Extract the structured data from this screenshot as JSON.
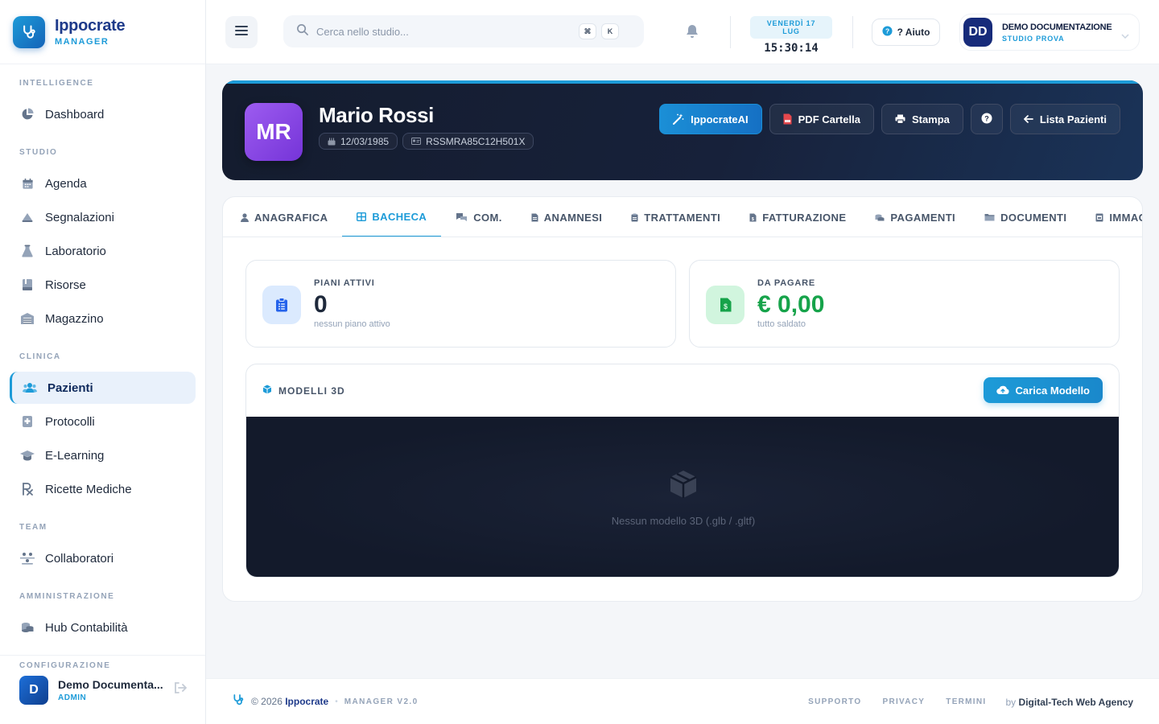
{
  "brand": {
    "name": "Ippocrate",
    "sub": "MANAGER"
  },
  "sidebar": {
    "sections": {
      "intelligence": "INTELLIGENCE",
      "studio": "STUDIO",
      "clinica": "CLINICA",
      "team": "TEAM",
      "amministrazione": "AMMINISTRAZIONE",
      "configurazione": "CONFIGURAZIONE"
    },
    "items": {
      "dashboard": "Dashboard",
      "agenda": "Agenda",
      "segnalazioni": "Segnalazioni",
      "laboratorio": "Laboratorio",
      "risorse": "Risorse",
      "magazzino": "Magazzino",
      "pazienti": "Pazienti",
      "protocolli": "Protocolli",
      "elearning": "E-Learning",
      "ricette": "Ricette Mediche",
      "collaboratori": "Collaboratori",
      "hub": "Hub Contabilità"
    },
    "active": "Pazienti",
    "user": {
      "initial": "D",
      "name": "Demo Documenta...",
      "role": "ADMIN"
    }
  },
  "topbar": {
    "search_placeholder": "Cerca nello studio...",
    "kbd": [
      "⌘",
      "K"
    ],
    "date": "VENERDÌ 17 LUG",
    "time": "15:30:14",
    "help_label": "? Aiuto",
    "user": {
      "initials": "DD",
      "name": "DEMO DOCUMENTAZIONE",
      "sub": "STUDIO PROVA"
    }
  },
  "patient": {
    "initials": "MR",
    "name": "Mario Rossi",
    "birth_date": "12/03/1985",
    "fiscal_code": "RSSMRA85C12H501X",
    "actions": {
      "ai": "IppocrateAI",
      "pdf": "PDF Cartella",
      "print": "Stampa",
      "back": "Lista Pazienti"
    }
  },
  "tabs": [
    {
      "label": "ANAGRAFICA",
      "icon": "user-icon"
    },
    {
      "label": "BACHECA",
      "icon": "grid-icon",
      "active": true
    },
    {
      "label": "COM.",
      "icon": "chat-icon"
    },
    {
      "label": "ANAMNESI",
      "icon": "file-icon"
    },
    {
      "label": "TRATTAMENTI",
      "icon": "clipboard-icon"
    },
    {
      "label": "FATTURAZIONE",
      "icon": "invoice-icon"
    },
    {
      "label": "PAGAMENTI",
      "icon": "coins-icon"
    },
    {
      "label": "DOCUMENTI",
      "icon": "folder-icon"
    },
    {
      "label": "IMMAGINI",
      "icon": "image-icon"
    }
  ],
  "stats": {
    "plans": {
      "label": "PIANI ATTIVI",
      "value": "0",
      "sub": "nessun piano attivo"
    },
    "due": {
      "label": "DA PAGARE",
      "value": "€ 0,00",
      "sub": "tutto saldato"
    }
  },
  "models": {
    "title": "MODELLI 3D",
    "upload_label": "Carica Modello",
    "empty_text": "Nessun modello 3D (.glb / .gltf)"
  },
  "footer": {
    "copy": "© 2026",
    "brand": "Ippocrate",
    "version": "MANAGER V2.0",
    "links": [
      "SUPPORTO",
      "PRIVACY",
      "TERMINI"
    ],
    "by_prefix": "by",
    "by_name": "Digital-Tech Web Agency"
  },
  "colors": {
    "accent": "#1d9bd8",
    "navy": "#1e3a8a",
    "header_bg": "#141c2e",
    "avatar_purple": "#8b48e6",
    "success": "#16a34a"
  }
}
